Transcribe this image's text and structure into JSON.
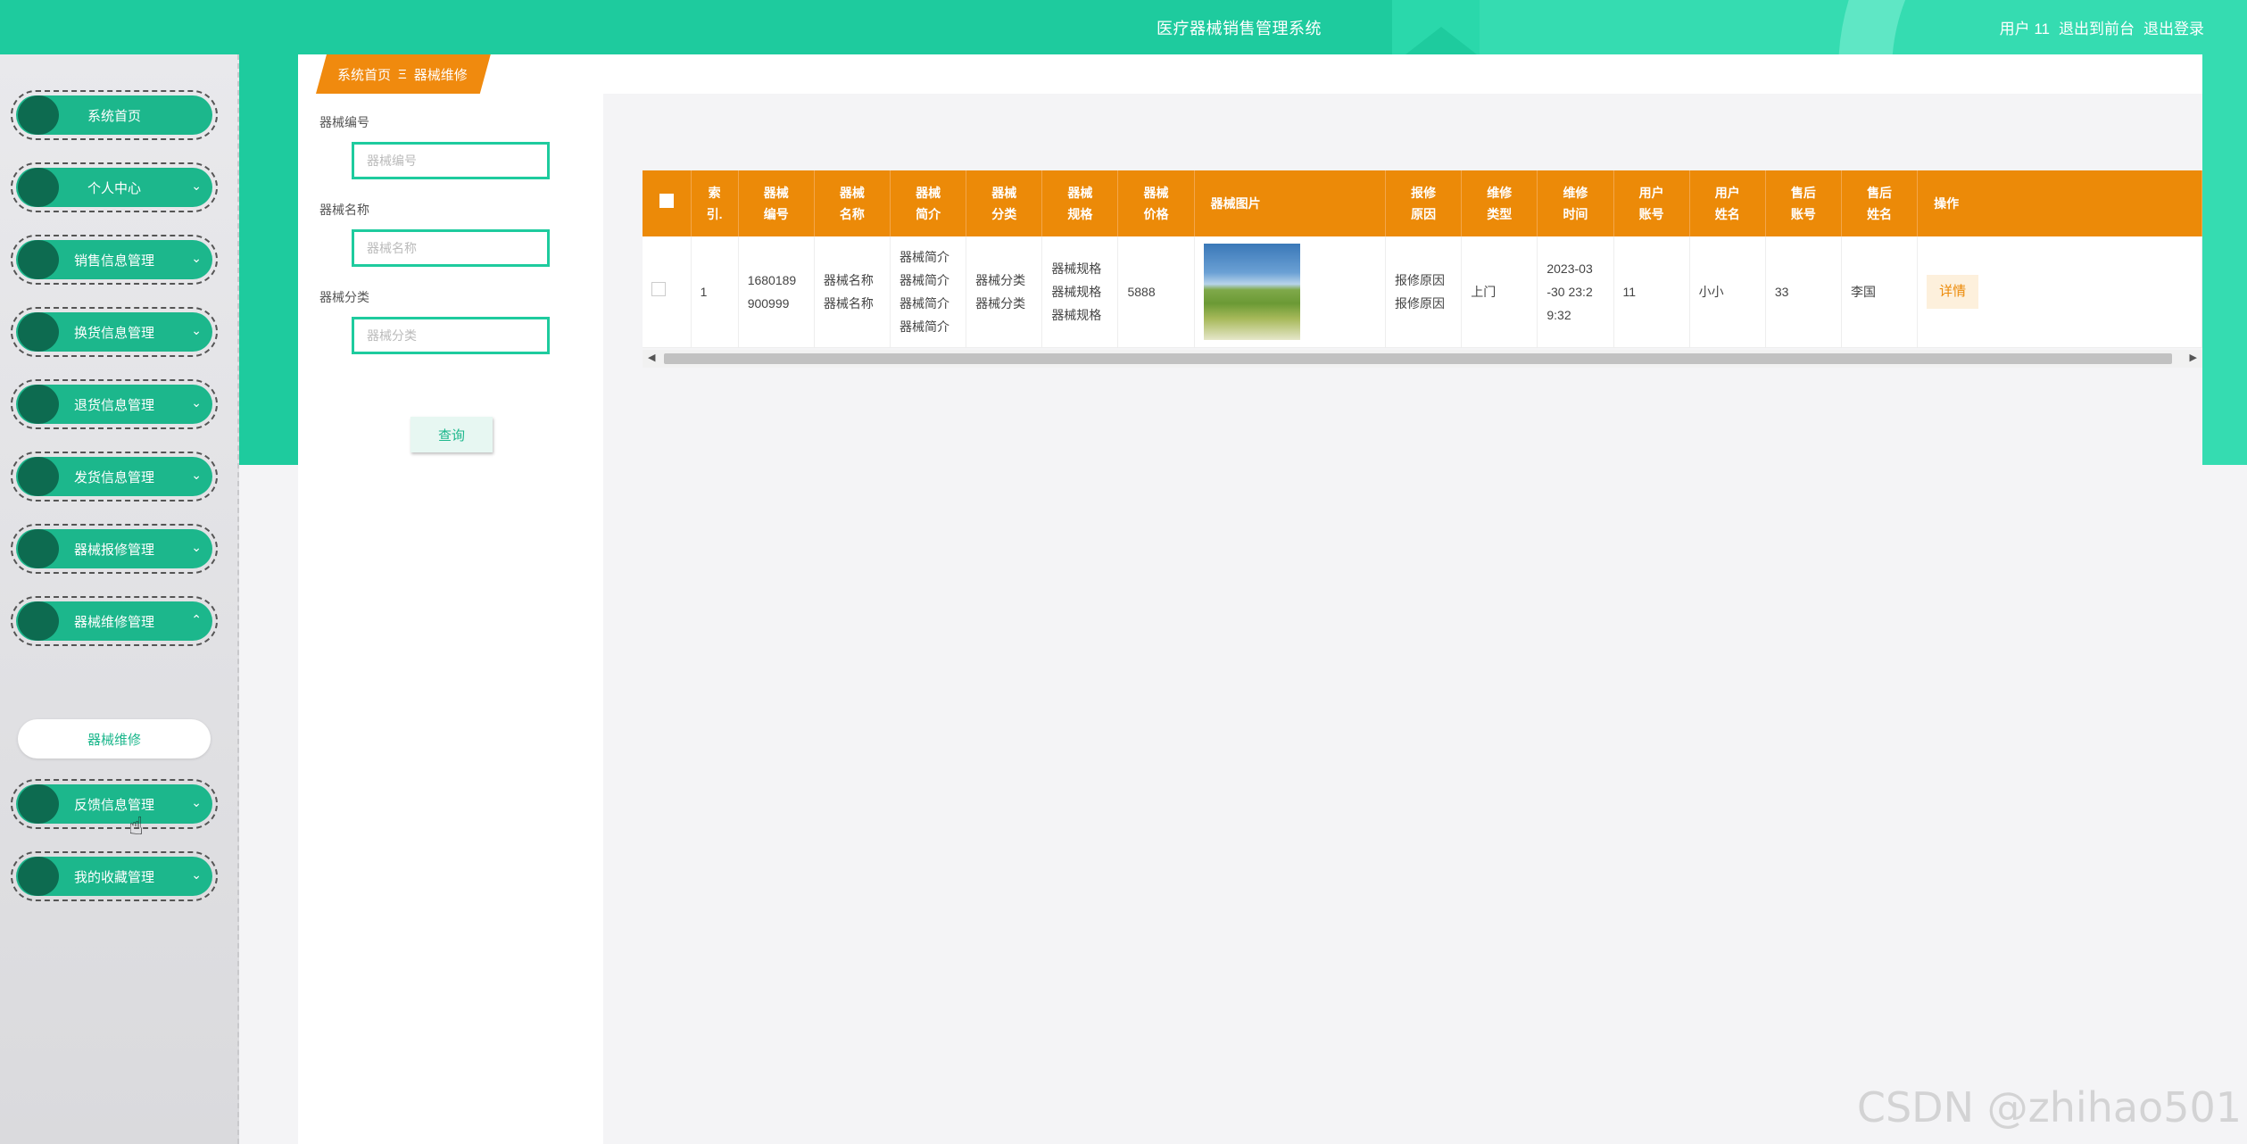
{
  "header": {
    "title": "医疗器械销售管理系统",
    "user": "用户 11",
    "links": [
      "退出到前台",
      "退出登录"
    ]
  },
  "sidebar": {
    "items": [
      {
        "label": "系统首页"
      },
      {
        "label": "个人中心"
      },
      {
        "label": "销售信息管理"
      },
      {
        "label": "换货信息管理"
      },
      {
        "label": "退货信息管理"
      },
      {
        "label": "发货信息管理"
      },
      {
        "label": "器械报修管理"
      },
      {
        "label": "器械维修管理"
      },
      {
        "label": "反馈信息管理"
      },
      {
        "label": "我的收藏管理"
      }
    ],
    "submenu": {
      "label": "器械维修"
    }
  },
  "breadcrumb": {
    "home": "系统首页",
    "separator": "Ξ",
    "current": "器械维修"
  },
  "search": {
    "fields": [
      {
        "label": "器械编号",
        "placeholder": "器械编号"
      },
      {
        "label": "器械名称",
        "placeholder": "器械名称"
      },
      {
        "label": "器械分类",
        "placeholder": "器械分类"
      }
    ],
    "button": "查询"
  },
  "table": {
    "headers": [
      {
        "l1": "索",
        "l2": "引."
      },
      {
        "l1": "器械",
        "l2": "编号"
      },
      {
        "l1": "器械",
        "l2": "名称"
      },
      {
        "l1": "器械",
        "l2": "简介"
      },
      {
        "l1": "器械",
        "l2": "分类"
      },
      {
        "l1": "器械",
        "l2": "规格"
      },
      {
        "l1": "器械",
        "l2": "价格"
      },
      {
        "l1": "器械图片",
        "l2": ""
      },
      {
        "l1": "报修",
        "l2": "原因"
      },
      {
        "l1": "维修",
        "l2": "类型"
      },
      {
        "l1": "维修",
        "l2": "时间"
      },
      {
        "l1": "用户",
        "l2": "账号"
      },
      {
        "l1": "用户",
        "l2": "姓名"
      },
      {
        "l1": "售后",
        "l2": "账号"
      },
      {
        "l1": "售后",
        "l2": "姓名"
      },
      {
        "l1": "操作",
        "l2": ""
      }
    ],
    "row": {
      "index": "1",
      "code_l1": "1680189",
      "code_l2": "900999",
      "name_l1": "器械名称",
      "name_l2": "器械名称",
      "intro_l1": "器械简介",
      "intro_l2": "器械简介",
      "intro_l3": "器械简介",
      "intro_l4": "器械简介",
      "category_l1": "器械分类",
      "category_l2": "器械分类",
      "spec_l1": "器械规格",
      "spec_l2": "器械规格",
      "spec_l3": "器械规格",
      "price": "5888",
      "reason_l1": "报修原因",
      "reason_l2": "报修原因",
      "repair_type": "上门",
      "time_l1": "2023-03",
      "time_l2": "-30 23:2",
      "time_l3": "9:32",
      "user_account": "11",
      "user_name": "小小",
      "service_account": "33",
      "service_name": "李国",
      "action": "详情"
    }
  },
  "watermark": "CSDN @zhihao501",
  "colors": {
    "primary": "#1ecb9e",
    "accent": "#ec8a08"
  }
}
